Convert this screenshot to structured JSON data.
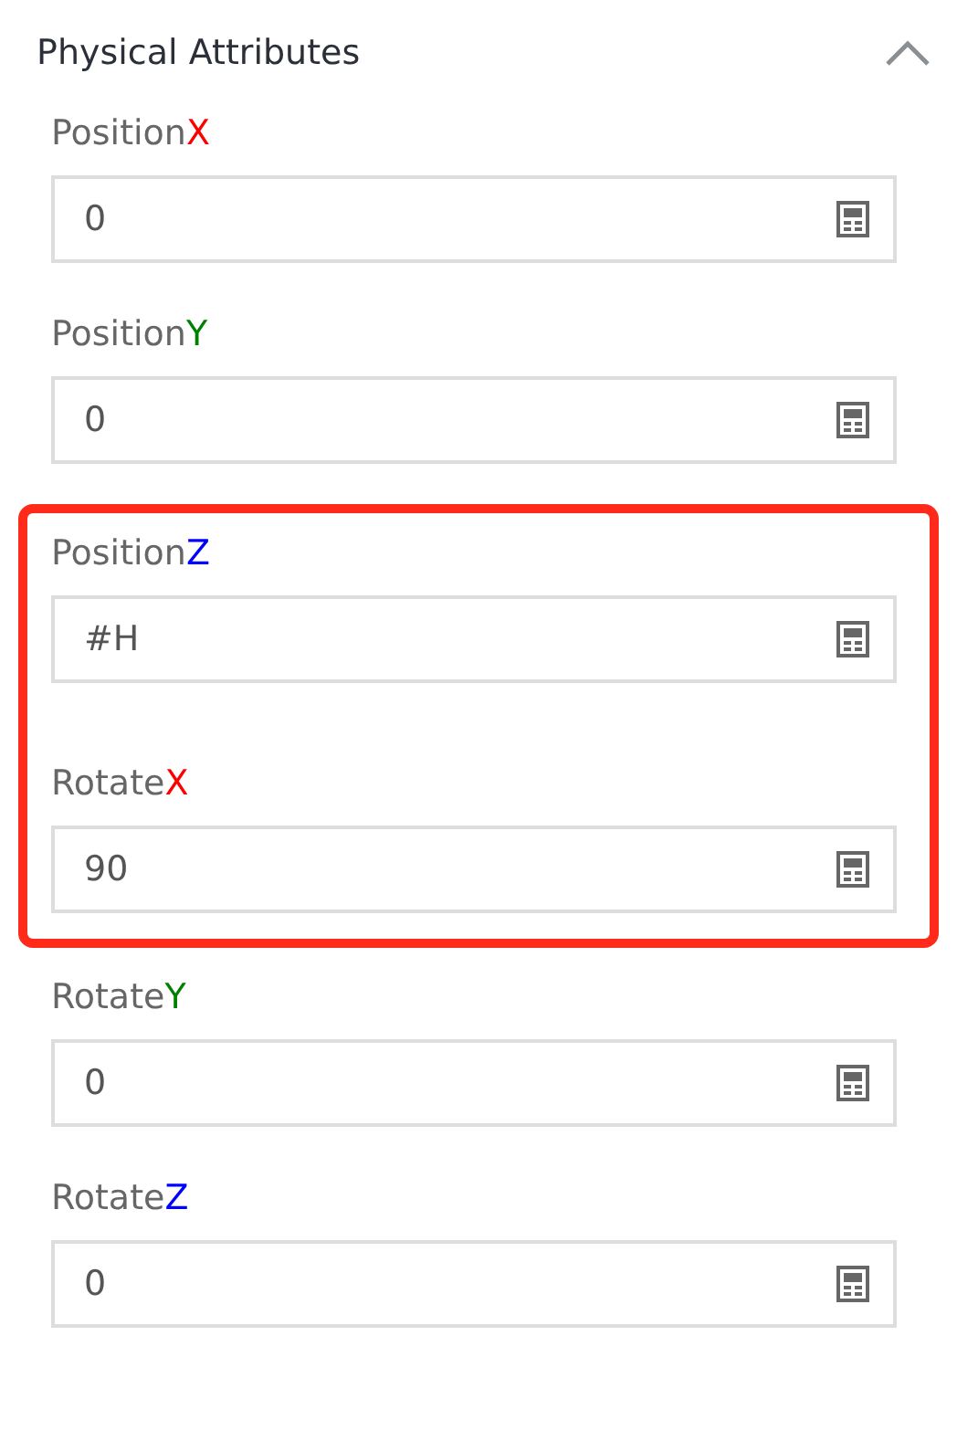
{
  "panel": {
    "title": "Physical Attributes",
    "expanded": true
  },
  "groups": [
    {
      "highlighted": false,
      "fields": [
        {
          "label": "Position",
          "axis": "X",
          "color": "#ff0000",
          "value": "0"
        },
        {
          "label": "Position",
          "axis": "Y",
          "color": "#008000",
          "value": "0"
        }
      ]
    },
    {
      "highlighted": true,
      "fields": [
        {
          "label": "Position",
          "axis": "Z",
          "color": "#0000ff",
          "value": "#H"
        },
        {
          "label": "Rotate",
          "axis": "X",
          "color": "#ff0000",
          "value": "90"
        }
      ]
    },
    {
      "highlighted": false,
      "fields": [
        {
          "label": "Rotate",
          "axis": "Y",
          "color": "#008000",
          "value": "0"
        },
        {
          "label": "Rotate",
          "axis": "Z",
          "color": "#0000ff",
          "value": "0"
        }
      ]
    }
  ]
}
